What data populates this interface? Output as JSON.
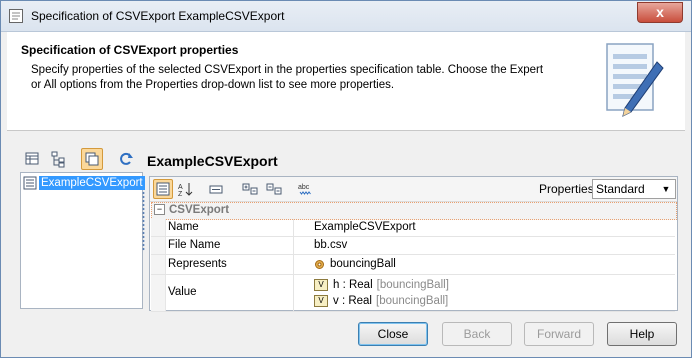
{
  "window": {
    "title": "Specification of CSVExport ExampleCSVExport",
    "close_glyph": "x"
  },
  "header": {
    "title": "Specification of CSVExport properties",
    "description": "Specify properties of the selected CSVExport in the properties specification table. Choose the Expert or All options from the Properties drop-down list to see more properties."
  },
  "left_toolbar": {
    "icons": [
      "table-view-icon",
      "tree-view-icon",
      "copy-icon",
      "refresh-icon"
    ]
  },
  "tree": {
    "selected_item": "ExampleCSVExport"
  },
  "element_title": "ExampleCSVExport",
  "properties_toolbar": {
    "label": "Properties:",
    "mode_value": "Standard",
    "icons": [
      "categorized-icon",
      "sort-alpha-icon",
      "field-icon",
      "expand-icon",
      "collapse-icon",
      "spell-icon"
    ]
  },
  "property_table": {
    "category": "CSVExport",
    "rows": [
      {
        "name": "Name",
        "value": "ExampleCSVExport"
      },
      {
        "name": "File Name",
        "value": "bb.csv"
      },
      {
        "name": "Represents",
        "value": "bouncingBall"
      },
      {
        "name": "Value",
        "values": [
          {
            "main": "h : Real",
            "context": "[bouncingBall]"
          },
          {
            "main": "v : Real",
            "context": "[bouncingBall]"
          }
        ]
      }
    ]
  },
  "buttons": {
    "close": "Close",
    "back": "Back",
    "forward": "Forward",
    "help": "Help"
  },
  "colors": {
    "selection": "#3399ff",
    "close_button": "#c94e3c",
    "active_toggle": "#fbd89a"
  }
}
